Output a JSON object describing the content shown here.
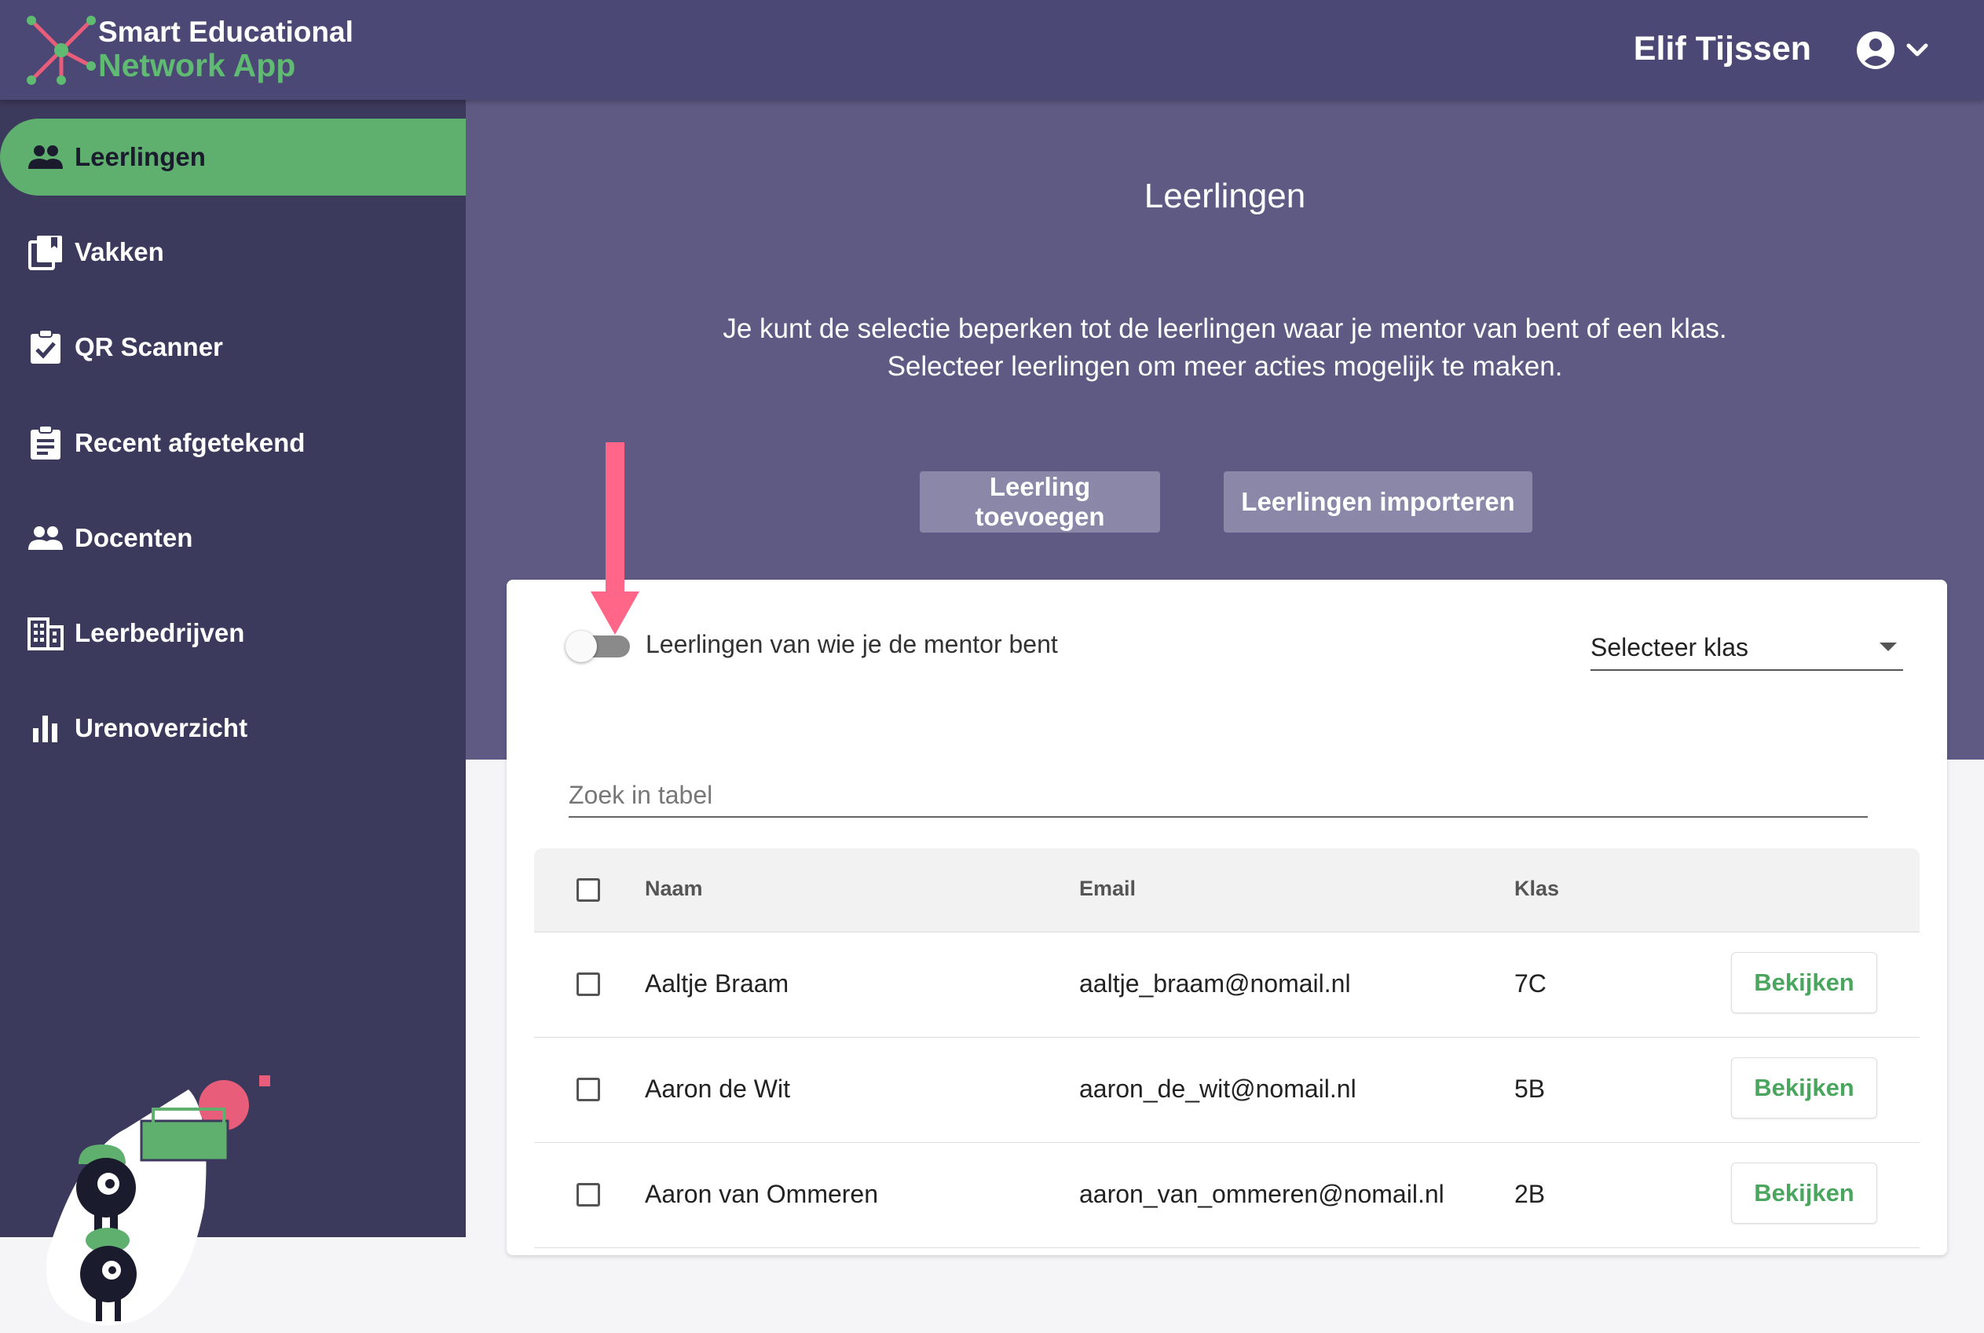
{
  "header": {
    "brand_line1": "Smart Educational",
    "brand_line2": "Network App",
    "user_name": "Elif Tijssen"
  },
  "sidebar": {
    "items": [
      {
        "label": "Leerlingen",
        "icon": "people-icon",
        "active": true
      },
      {
        "label": "Vakken",
        "icon": "books-icon",
        "active": false
      },
      {
        "label": "QR Scanner",
        "icon": "clipboard-check-icon",
        "active": false
      },
      {
        "label": "Recent afgetekend",
        "icon": "clipboard-list-icon",
        "active": false
      },
      {
        "label": "Docenten",
        "icon": "people-icon",
        "active": false
      },
      {
        "label": "Leerbedrijven",
        "icon": "building-icon",
        "active": false
      },
      {
        "label": "Urenoverzicht",
        "icon": "bar-chart-icon",
        "active": false
      }
    ]
  },
  "main": {
    "title": "Leerlingen",
    "desc_line1": "Je kunt de selectie beperken tot de leerlingen waar je mentor van bent of een klas.",
    "desc_line2": "Selecteer leerlingen om meer acties mogelijk te maken.",
    "add_button": "Leerling toevoegen",
    "import_button": "Leerlingen importeren",
    "mentor_toggle_label": "Leerlingen van wie je de mentor bent",
    "mentor_toggle_on": false,
    "class_select_value": "Selecteer klas",
    "search_placeholder": "Zoek in tabel"
  },
  "table": {
    "headers": {
      "name": "Naam",
      "email": "Email",
      "class": "Klas"
    },
    "rows": [
      {
        "name": "Aaltje Braam",
        "email": "aaltje_braam@nomail.nl",
        "class": "7C",
        "action": "Bekijken"
      },
      {
        "name": "Aaron de Wit",
        "email": "aaron_de_wit@nomail.nl",
        "class": "5B",
        "action": "Bekijken"
      },
      {
        "name": "Aaron van Ommeren",
        "email": "aaron_van_ommeren@nomail.nl",
        "class": "2B",
        "action": "Bekijken"
      }
    ]
  },
  "colors": {
    "header_bg": "#4b4875",
    "sidebar_bg": "#3c3a5c",
    "active_green": "#5fb06f",
    "main_bg": "#5e5a84",
    "accent_pink": "#ff6688"
  }
}
